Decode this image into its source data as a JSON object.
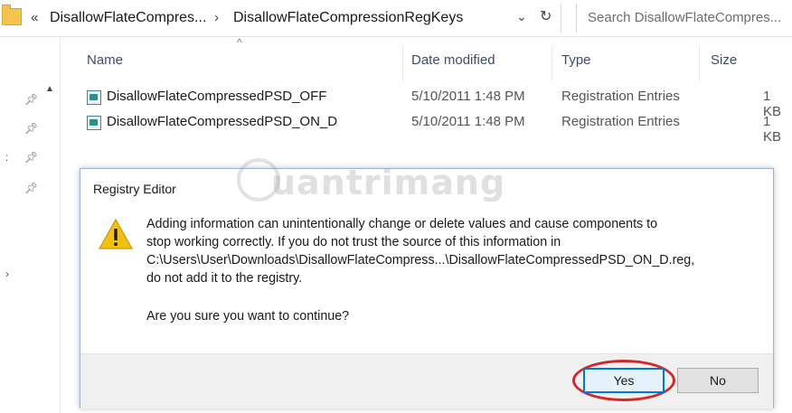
{
  "address_bar": {
    "overflow_glyph": "«",
    "crumbs": [
      "DisallowFlateCompres...",
      "DisallowFlateCompressionRegKeys"
    ],
    "separator": "›",
    "dropdown_glyph": "⌄",
    "refresh_glyph": "↻",
    "search_placeholder": "Search DisallowFlateCompres..."
  },
  "columns": {
    "name": "Name",
    "date_modified": "Date modified",
    "type": "Type",
    "size": "Size",
    "sort_glyph": "^"
  },
  "files": [
    {
      "name": "DisallowFlateCompressedPSD_OFF",
      "date": "5/10/2011 1:48 PM",
      "type": "Registration Entries",
      "size": "1 KB"
    },
    {
      "name": "DisallowFlateCompressedPSD_ON_D",
      "date": "5/10/2011 1:48 PM",
      "type": "Registration Entries",
      "size": "1 KB"
    }
  ],
  "dialog": {
    "title": "Registry Editor",
    "message_lines": [
      "Adding information can unintentionally change or delete values and cause components to",
      "stop working correctly. If you do not trust the source of this information in",
      "C:\\Users\\User\\Downloads\\DisallowFlateCompress...\\DisallowFlateCompressedPSD_ON_D.reg,",
      "do not add it to the registry."
    ],
    "question": "Are you sure you want to continue?",
    "yes_label": "Yes",
    "no_label": "No",
    "highlight_color": "#d7262a"
  },
  "watermark": {
    "text": "uantrimang"
  },
  "colors": {
    "accent": "#0078d7",
    "header_text": "#3b4e6a",
    "warning": "#f4c20d"
  },
  "icons": {
    "folder": "folder-icon",
    "pin": "pin-icon",
    "file": "registry-file-icon",
    "warning": "warning-icon"
  }
}
